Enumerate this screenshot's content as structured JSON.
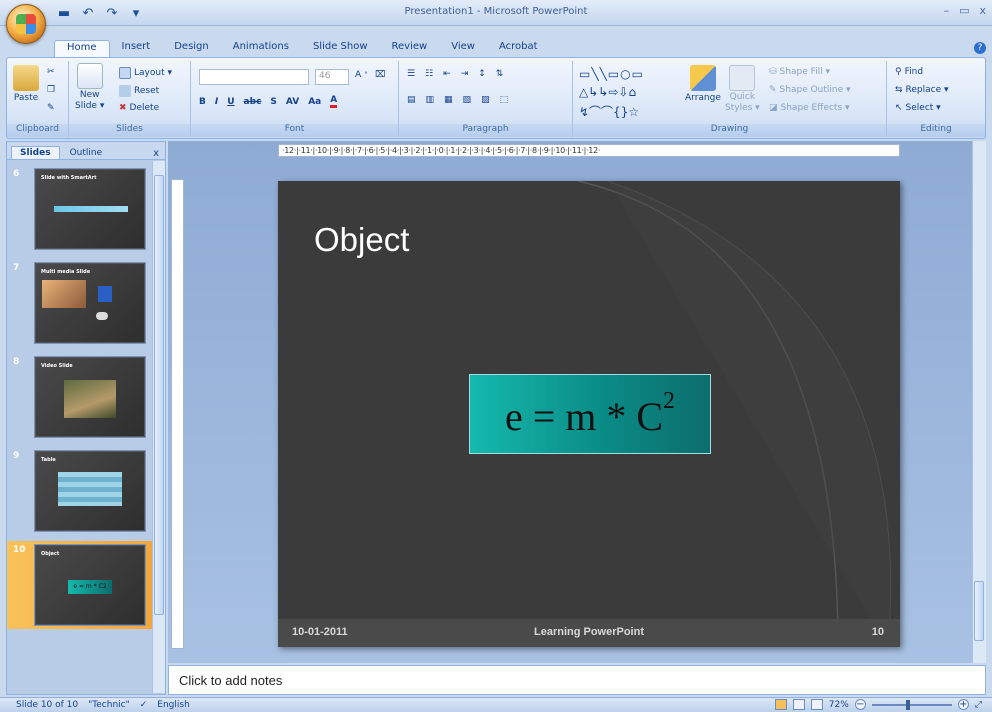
{
  "window": {
    "title": "Presentation1 - Microsoft PowerPoint",
    "controls": [
      "–",
      "▭",
      "x"
    ]
  },
  "quick_access": {
    "save_icon": "save-icon",
    "undo_icon": "undo-icon",
    "redo_icon": "redo-icon",
    "more": "▾"
  },
  "tabs": [
    "Home",
    "Insert",
    "Design",
    "Animations",
    "Slide Show",
    "Review",
    "View",
    "Acrobat"
  ],
  "active_tab": "Home",
  "ribbon": {
    "clipboard": {
      "label": "Clipboard",
      "paste": "Paste"
    },
    "slides": {
      "label": "Slides",
      "new_slide_line1": "New",
      "new_slide_line2": "Slide ▾",
      "layout": "Layout ▾",
      "reset": "Reset",
      "delete": "Delete"
    },
    "font": {
      "label": "Font",
      "size": "46"
    },
    "paragraph": {
      "label": "Paragraph"
    },
    "drawing": {
      "label": "Drawing",
      "arrange": "Arrange",
      "quick_styles_line1": "Quick",
      "quick_styles_line2": "Styles ▾",
      "shape_fill": "Shape Fill ▾",
      "shape_outline": "Shape Outline ▾",
      "shape_effects": "Shape Effects ▾"
    },
    "editing": {
      "label": "Editing",
      "find": "Find",
      "replace": "Replace ▾",
      "select": "Select ▾"
    }
  },
  "left_pane": {
    "tabs": [
      "Slides",
      "Outline"
    ],
    "close": "x",
    "thumbnails": [
      {
        "number": "6",
        "title": "Slide with SmartArt"
      },
      {
        "number": "7",
        "title": "Multi media Slide"
      },
      {
        "number": "8",
        "title": "Video Slide"
      },
      {
        "number": "9",
        "title": "Table"
      },
      {
        "number": "10",
        "title": "Object",
        "content": "e = m * C2"
      }
    ]
  },
  "ruler": {
    "text": "·12·|·11·|·10·|·9·|·8·|·7·|·6·|·5·|·4·|·3·|·2·|·1·|·0·|·1·|·2·|·3·|·4·|·5·|·6·|·7·|·8·|·9·|·10·|·11·|·12·"
  },
  "slide": {
    "title": "Object",
    "equation_main": "e = m * C",
    "equation_exp": "2",
    "footer_date": "10-01-2011",
    "footer_text": "Learning PowerPoint",
    "footer_number": "10"
  },
  "notes": {
    "placeholder": "Click to add notes"
  },
  "status": {
    "slide_info": "Slide 10 of 10",
    "theme": "\"Technic\"",
    "language": "English",
    "zoom": "72%",
    "zoom_level": 0.45
  }
}
